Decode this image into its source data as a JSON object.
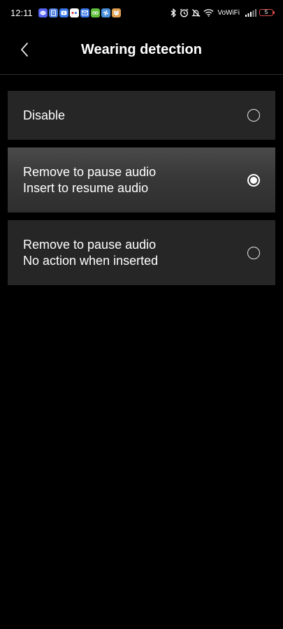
{
  "status_bar": {
    "time": "12:11",
    "network_label": "VoWiFi",
    "battery_level": "5",
    "notification_icons": [
      {
        "name": "discord-icon",
        "color": "#5865f2"
      },
      {
        "name": "notes-icon",
        "color": "#4a7bd9"
      },
      {
        "name": "youtube-icon",
        "color": "#3b78e7"
      },
      {
        "name": "app-icon",
        "color": "#ffffff"
      },
      {
        "name": "mail-icon",
        "color": "#3b78e7"
      },
      {
        "name": "game-icon",
        "color": "#5fbf3a"
      },
      {
        "name": "fan-icon",
        "color": "#4a90d9"
      },
      {
        "name": "cat-icon",
        "color": "#e0a050"
      }
    ],
    "system_icons": [
      "bluetooth-icon",
      "alarm-icon",
      "mute-icon",
      "wifi-icon",
      "signal-icon",
      "battery-icon"
    ]
  },
  "header": {
    "title": "Wearing detection",
    "back_icon": "chevron-left-icon"
  },
  "options": [
    {
      "lines": [
        "Disable"
      ],
      "selected": false
    },
    {
      "lines": [
        "Remove to pause audio",
        "Insert to resume audio"
      ],
      "selected": true
    },
    {
      "lines": [
        "Remove to pause audio",
        "No action when inserted"
      ],
      "selected": false
    }
  ],
  "colors": {
    "background": "#000000",
    "option_background": "#262626",
    "selected_option_background": "#3a3a3a",
    "battery_outline": "#d94a4a"
  }
}
